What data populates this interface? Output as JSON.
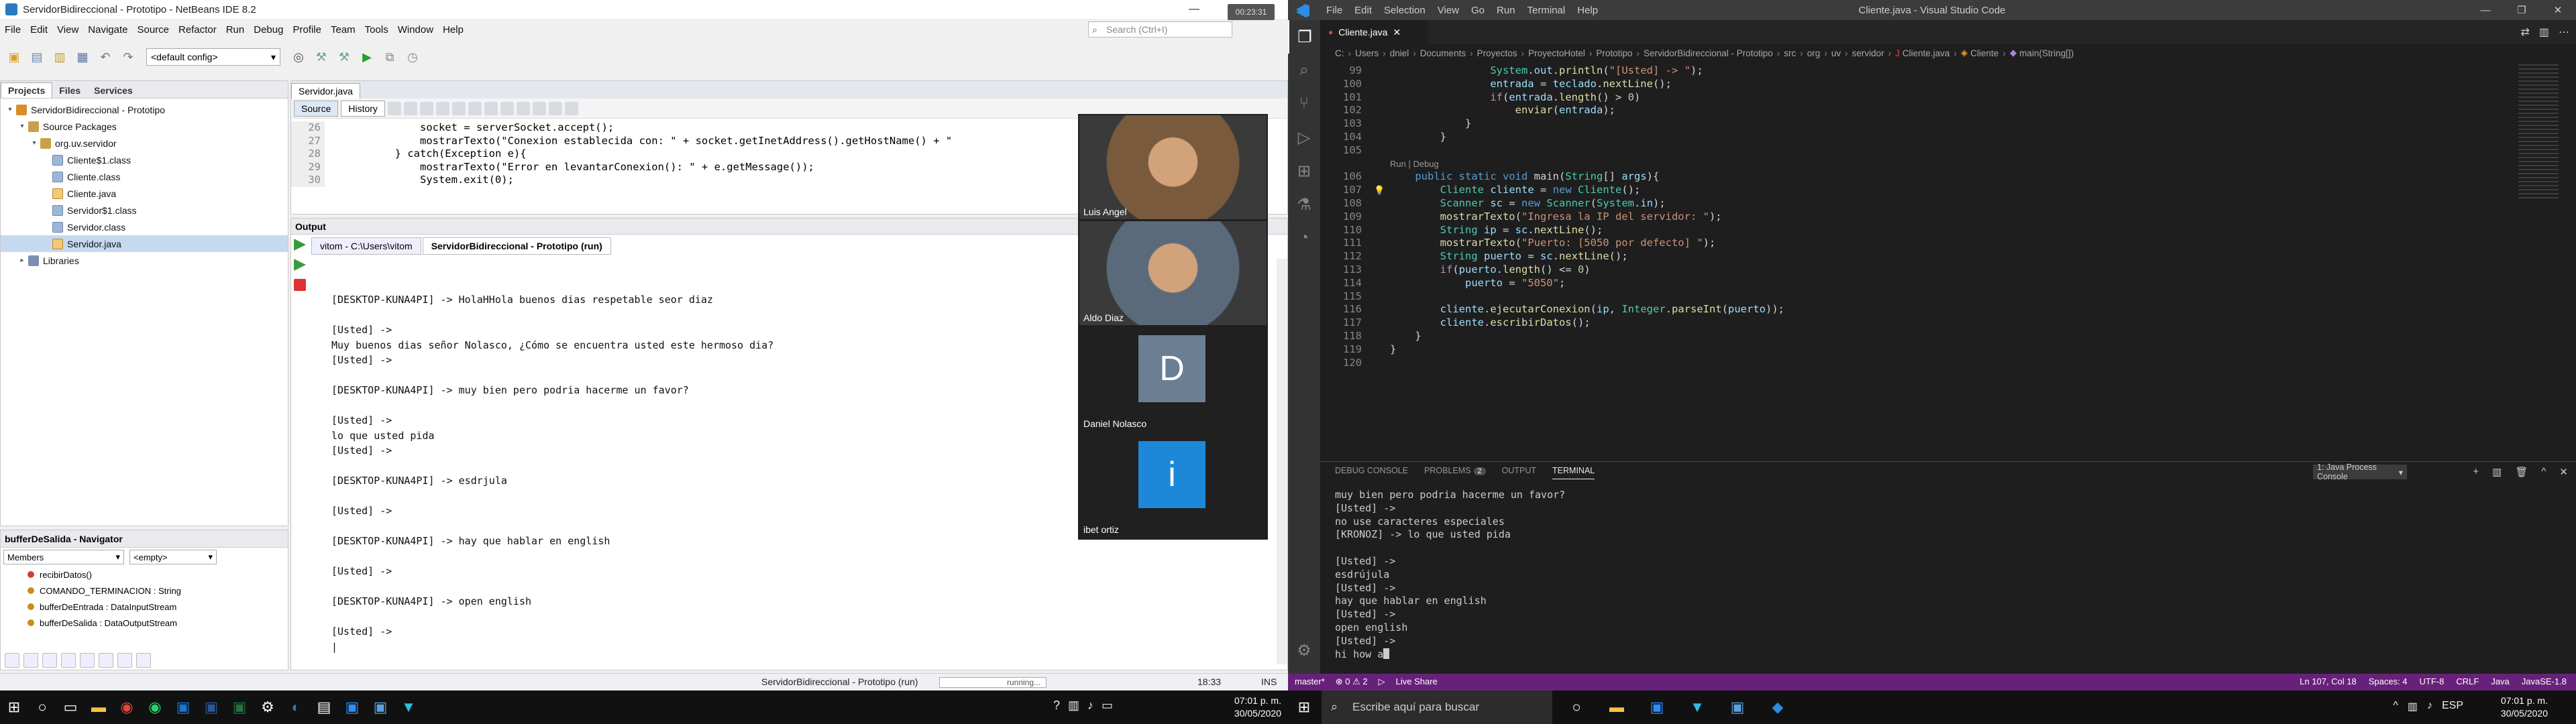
{
  "netbeans": {
    "title": "ServidorBidireccional - Prototipo - NetBeans IDE 8.2",
    "badge": "00:23:31",
    "menu": [
      "File",
      "Edit",
      "View",
      "Navigate",
      "Source",
      "Refactor",
      "Run",
      "Debug",
      "Profile",
      "Team",
      "Tools",
      "Window",
      "Help"
    ],
    "search_placeholder": "Search (Ctrl+I)",
    "config": "<default config>",
    "projects_tabs": [
      "Projects",
      "Files",
      "Services"
    ],
    "tree": [
      {
        "label": "ServidorBidireccional - Prototipo",
        "level": 0,
        "type": "proj",
        "tw": "▾"
      },
      {
        "label": "Source Packages",
        "level": 1,
        "type": "pkg",
        "tw": "▾"
      },
      {
        "label": "org.uv.servidor",
        "level": 2,
        "type": "pkg",
        "tw": "▾"
      },
      {
        "label": "Cliente$1.class",
        "level": 3,
        "type": "cls",
        "tw": ""
      },
      {
        "label": "Cliente.class",
        "level": 3,
        "type": "cls",
        "tw": ""
      },
      {
        "label": "Cliente.java",
        "level": 3,
        "type": "java",
        "tw": ""
      },
      {
        "label": "Servidor$1.class",
        "level": 3,
        "type": "cls",
        "tw": ""
      },
      {
        "label": "Servidor.class",
        "level": 3,
        "type": "cls",
        "tw": ""
      },
      {
        "label": "Servidor.java",
        "level": 3,
        "type": "java",
        "tw": "",
        "selected": true
      },
      {
        "label": "Libraries",
        "level": 1,
        "type": "lib",
        "tw": "▸"
      }
    ],
    "navigator": {
      "title": "bufferDeSalida - Navigator",
      "filter": "Members",
      "filter_empty": "<empty>",
      "members": [
        {
          "label": "recibirDatos()",
          "color": "#c84040"
        },
        {
          "label": "COMANDO_TERMINACION : String",
          "color": "#d08a1c"
        },
        {
          "label": "bufferDeEntrada : DataInputStream",
          "color": "#d08a1c"
        },
        {
          "label": "bufferDeSalida : DataOutputStream",
          "color": "#d08a1c"
        }
      ]
    },
    "editor": {
      "tab": "Servidor.java",
      "source": "Source",
      "history": "History",
      "lines": [
        {
          "n": "26",
          "t": "            socket = serverSocket.accept();"
        },
        {
          "n": "27",
          "t": "            mostrarTexto(\"Conexion establecida con: \" + socket.getInetAddress().getHostName() + \""
        },
        {
          "n": "28",
          "t": "        } catch(Exception e){"
        },
        {
          "n": "29",
          "t": "            mostrarTexto(\"Error en levantarConexion(): \" + e.getMessage());"
        },
        {
          "n": "30",
          "t": "            System.exit(0);"
        }
      ]
    },
    "output": {
      "title": "Output",
      "tabs": [
        "vitom - C:\\Users\\vitom",
        "ServidorBidireccional - Prototipo (run)"
      ],
      "lines": [
        "[DESKTOP-KUNA4PI] -> HolaHHola buenos dias respetable seor diaz",
        "",
        "[Usted] ->",
        "Muy buenos dias señor Nolasco, ¿Cómo se encuentra usted este hermoso dia?",
        "[Usted] ->",
        "",
        "[DESKTOP-KUNA4PI] -> muy bien pero podria hacerme un favor?",
        "",
        "[Usted] ->",
        "lo que usted pida",
        "[Usted] ->",
        "",
        "[DESKTOP-KUNA4PI] -> esdrjula",
        "",
        "[Usted] ->",
        "",
        "[DESKTOP-KUNA4PI] -> hay que hablar en english",
        "",
        "[Usted] ->",
        "",
        "[DESKTOP-KUNA4PI] -> open english",
        "",
        "[Usted] ->"
      ]
    },
    "status": {
      "task": "ServidorBidireccional - Prototipo (run)",
      "progress": "running...",
      "pos": "18:33",
      "mode": "INS"
    },
    "taskbar_time": "07:01 p. m.",
    "taskbar_date": "30/05/2020"
  },
  "call": {
    "participants": [
      {
        "name": "Luis Angel",
        "video": true,
        "bg": "#7a5a3c"
      },
      {
        "name": "Aldo Diaz",
        "video": true,
        "bg": "#5a6a7a"
      },
      {
        "name": "Daniel Nolasco",
        "video": false,
        "initial": "D",
        "color": "#6a7f94"
      },
      {
        "name": "ibet ortiz",
        "video": false,
        "initial": "i",
        "color": "#1e88d8"
      }
    ]
  },
  "vscode": {
    "title": "Cliente.java - Visual Studio Code",
    "menu": [
      "File",
      "Edit",
      "Selection",
      "View",
      "Go",
      "Run",
      "Terminal",
      "Help"
    ],
    "tab": "Cliente.java",
    "breadcrumb": [
      "C:",
      "Users",
      "dniel",
      "Documents",
      "Proyectos",
      "ProyectoHotel",
      "Prototipo",
      "ServidorBidireccional - Prototipo",
      "src",
      "org",
      "uv",
      "servidor",
      "Cliente.java",
      "Cliente",
      "main(String[])"
    ],
    "codelens": "Run | Debug",
    "code_before": [
      {
        "n": "99",
        "t": "                System.out.println(\"[Usted] -> \");"
      },
      {
        "n": "100",
        "t": "                entrada = teclado.nextLine();"
      },
      {
        "n": "101",
        "t": "                if(entrada.length() > 0)"
      },
      {
        "n": "102",
        "t": "                    enviar(entrada);"
      },
      {
        "n": "103",
        "t": "            }"
      },
      {
        "n": "104",
        "t": "        }"
      },
      {
        "n": "105",
        "t": ""
      }
    ],
    "code_after": [
      {
        "n": "106",
        "t": "    public static void main(String[] args){"
      },
      {
        "n": "107",
        "t": "        Cliente cliente = new Cliente();",
        "bulb": true
      },
      {
        "n": "108",
        "t": "        Scanner sc = new Scanner(System.in);"
      },
      {
        "n": "109",
        "t": "        mostrarTexto(\"Ingresa la IP del servidor: \");"
      },
      {
        "n": "110",
        "t": "        String ip = sc.nextLine();"
      },
      {
        "n": "111",
        "t": "        mostrarTexto(\"Puerto: [5050 por defecto] \");"
      },
      {
        "n": "112",
        "t": "        String puerto = sc.nextLine();"
      },
      {
        "n": "113",
        "t": "        if(puerto.length() <= 0)"
      },
      {
        "n": "114",
        "t": "            puerto = \"5050\";"
      },
      {
        "n": "115",
        "t": ""
      },
      {
        "n": "116",
        "t": "        cliente.ejecutarConexion(ip, Integer.parseInt(puerto));"
      },
      {
        "n": "117",
        "t": "        cliente.escribirDatos();"
      },
      {
        "n": "118",
        "t": "    }"
      },
      {
        "n": "119",
        "t": "}"
      },
      {
        "n": "120",
        "t": ""
      }
    ],
    "panel_tabs": [
      "DEBUG CONSOLE",
      "PROBLEMS",
      "OUTPUT",
      "TERMINAL"
    ],
    "problems_count": "2",
    "terminal_select": "1: Java Process Console",
    "terminal": [
      "muy bien pero podria hacerme un favor?",
      "[Usted] ->",
      "no use caracteres especiales",
      "[KRONOZ] -> lo que usted pida",
      "",
      "[Usted] ->",
      "esdrújula",
      "[Usted] ->",
      "hay que hablar en english",
      "[Usted] ->",
      "open english",
      "[Usted] ->"
    ],
    "terminal_input": "hi how a",
    "status_left": [
      "master*",
      "⊗ 0 ⚠ 2",
      "▷",
      "Live Share"
    ],
    "status_right": [
      "Ln 107, Col 18",
      "Spaces: 4",
      "UTF-8",
      "CRLF",
      "Java",
      "JavaSE-1.8"
    ],
    "taskbar_search": "Escribe aquí para buscar",
    "lang": "ESP",
    "taskbar_time": "07:01 p. m.",
    "taskbar_date": "30/05/2020"
  }
}
